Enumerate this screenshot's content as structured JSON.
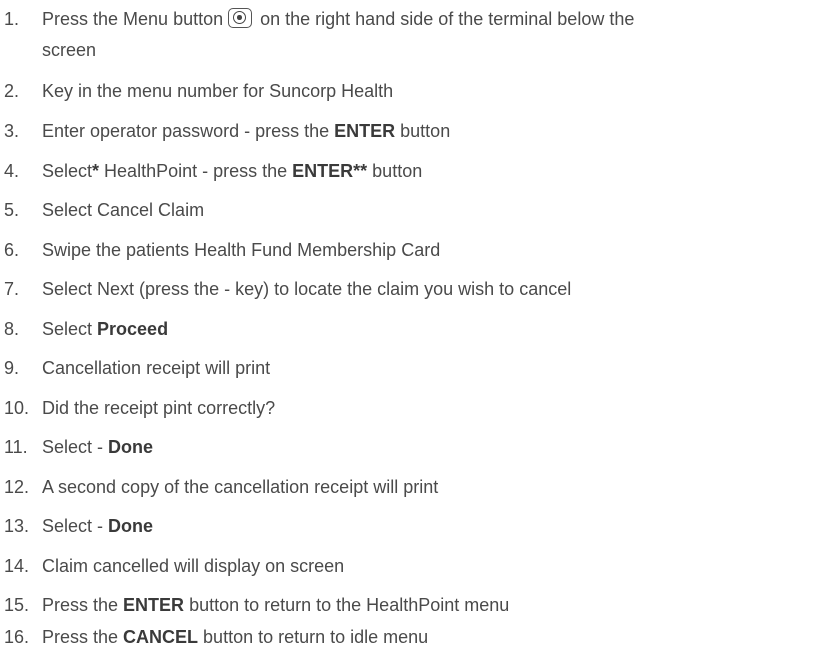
{
  "steps": [
    {
      "num": "1.",
      "a": "Press the Menu button",
      "icon": "menu-button-icon",
      "b": " on the right hand side of the terminal below the",
      "cont": "screen"
    },
    {
      "num": "2.",
      "a": "Key in  the menu number for Suncorp Health"
    },
    {
      "num": "3.",
      "a": "Enter operator password - press the ",
      "bold1": "ENTER",
      "b": " button"
    },
    {
      "num": "4.",
      "a": "Select",
      "bold1": "*",
      "b": " HealthPoint - press the ",
      "bold2": "ENTER**",
      "c": " button"
    },
    {
      "num": "5.",
      "a": "Select Cancel Claim"
    },
    {
      "num": "6.",
      "a": "Swipe the patients Health Fund Membership Card"
    },
    {
      "num": "7.",
      "a": "Select Next  (press the - key) to locate the claim you wish to cancel"
    },
    {
      "num": "8.",
      "a": "Select ",
      "bold1": "Proceed"
    },
    {
      "num": "9.",
      "a": "Cancellation receipt will print"
    },
    {
      "num": "10.",
      "a": "Did the receipt pint correctly?"
    },
    {
      "num": "11.",
      "a": "Select - ",
      "bold1": "Done"
    },
    {
      "num": "12.",
      "a": "A second copy of the cancellation receipt will print"
    },
    {
      "num": "13.",
      "a": "Select - ",
      "bold1": "Done"
    },
    {
      "num": "14.",
      "a": "Claim cancelled will display on screen"
    },
    {
      "num": "15.",
      "a": "Press the ",
      "bold1": "ENTER",
      "b": " button to return to the HealthPoint menu"
    },
    {
      "num": "16.",
      "a": "Press the ",
      "bold1": "CANCEL",
      "b": " button to return to idle menu"
    }
  ]
}
